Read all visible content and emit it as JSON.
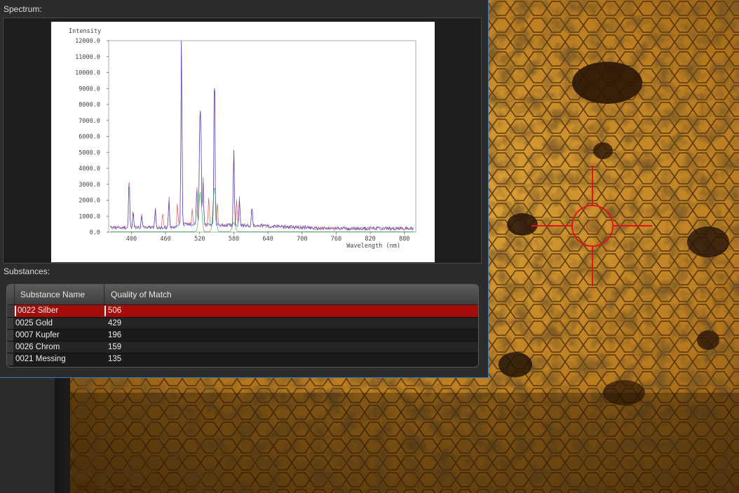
{
  "dialog": {
    "spectrum_label": "Spectrum:",
    "substances_label": "Substances:"
  },
  "chart_data": {
    "type": "line",
    "ylabel": "Intensity",
    "xlabel": "Wavelength (nm)",
    "xlim": [
      360,
      900
    ],
    "ylim": [
      0,
      12000
    ],
    "x_ticks": [
      400,
      460,
      520,
      580,
      640,
      700,
      760,
      820,
      880
    ],
    "y_ticks": [
      "12000.0",
      "11000.0",
      "10000.0",
      "9000.0",
      "8000.0",
      "7000.0",
      "6000.0",
      "5000.0",
      "4000.0",
      "3000.0",
      "2000.0",
      "1000.0",
      "0.0"
    ],
    "grid": false,
    "series": [
      {
        "color": "#d83a3a",
        "peaks": [
          [
            396,
            3400
          ],
          [
            403,
            1100
          ],
          [
            418,
            800
          ],
          [
            442,
            1300
          ],
          [
            455,
            900
          ],
          [
            466,
            1900
          ],
          [
            481,
            1300
          ],
          [
            488,
            12000
          ],
          [
            507,
            1100
          ],
          [
            515,
            2600
          ],
          [
            520,
            5800
          ],
          [
            522,
            6700
          ],
          [
            526,
            3000
          ],
          [
            536,
            1800
          ],
          [
            546,
            10500
          ],
          [
            551,
            1500
          ],
          [
            580,
            4900
          ],
          [
            585,
            1600
          ],
          [
            590,
            1800
          ],
          [
            612,
            1300
          ]
        ]
      },
      {
        "color": "#2b3fd8",
        "peaks": [
          [
            396,
            3200
          ],
          [
            403,
            1000
          ],
          [
            418,
            700
          ],
          [
            442,
            1100
          ],
          [
            466,
            1700
          ],
          [
            488,
            11800
          ],
          [
            515,
            2400
          ],
          [
            520,
            5600
          ],
          [
            522,
            6600
          ],
          [
            526,
            2800
          ],
          [
            546,
            10300
          ],
          [
            580,
            4800
          ],
          [
            590,
            1700
          ],
          [
            612,
            1200
          ]
        ]
      },
      {
        "color": "#2aaa4a",
        "peaks": [
          [
            521,
            2500
          ],
          [
            546,
            2800
          ],
          [
            580,
            600
          ]
        ]
      }
    ]
  },
  "table": {
    "headers": [
      "Substance Name",
      "Quality of Match"
    ],
    "rows": [
      {
        "name": "0022 Silber",
        "quality": "506"
      },
      {
        "name": "0025 Gold",
        "quality": "429"
      },
      {
        "name": "0007 Kupfer",
        "quality": "196"
      },
      {
        "name": "0026 Chrom",
        "quality": "159"
      },
      {
        "name": "0021 Messing",
        "quality": "135"
      }
    ]
  },
  "colors": {
    "selection": "#a40b0b",
    "dialog_border": "#3a7bb8",
    "crosshair": "#e01616"
  },
  "icons": {
    "reticle": "crosshair-icon"
  }
}
